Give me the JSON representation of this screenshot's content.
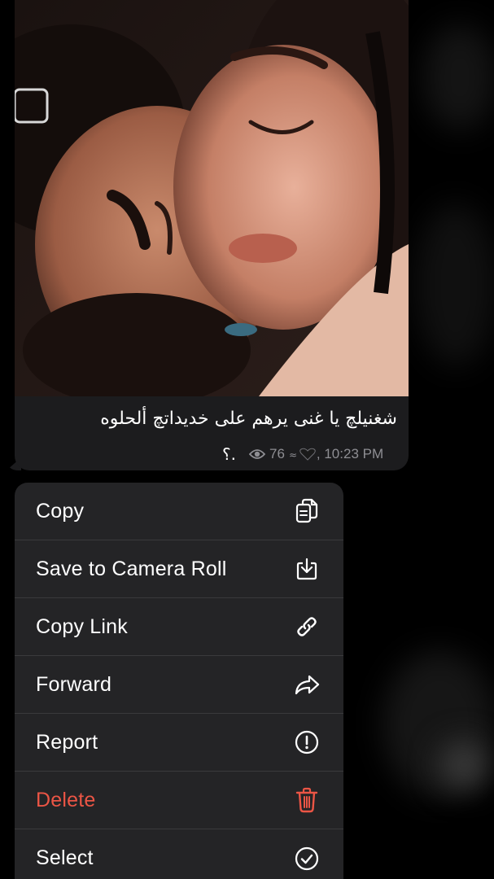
{
  "message": {
    "caption": "شغنيلچ يا غنى يرهم على خديداتچ ألحلوه",
    "caption_tail": "؟.",
    "views": "76",
    "reaction_icon": "heart-icon",
    "time": ", 10:23 PM"
  },
  "context_menu": {
    "items": [
      {
        "label": "Copy",
        "icon": "copy-icon",
        "destructive": false
      },
      {
        "label": "Save to Camera Roll",
        "icon": "download-icon",
        "destructive": false
      },
      {
        "label": "Copy Link",
        "icon": "link-icon",
        "destructive": false
      },
      {
        "label": "Forward",
        "icon": "forward-arrow-icon",
        "destructive": false
      },
      {
        "label": "Report",
        "icon": "exclamation-circle-icon",
        "destructive": false
      },
      {
        "label": "Delete",
        "icon": "trash-icon",
        "destructive": true
      },
      {
        "label": "Select",
        "icon": "checkmark-circle-icon",
        "destructive": false
      }
    ]
  },
  "colors": {
    "background": "#000000",
    "bubble": "#1c1c1e",
    "menu": "#242426",
    "destructive": "#eb5545",
    "meta_text": "#8e8e93"
  }
}
